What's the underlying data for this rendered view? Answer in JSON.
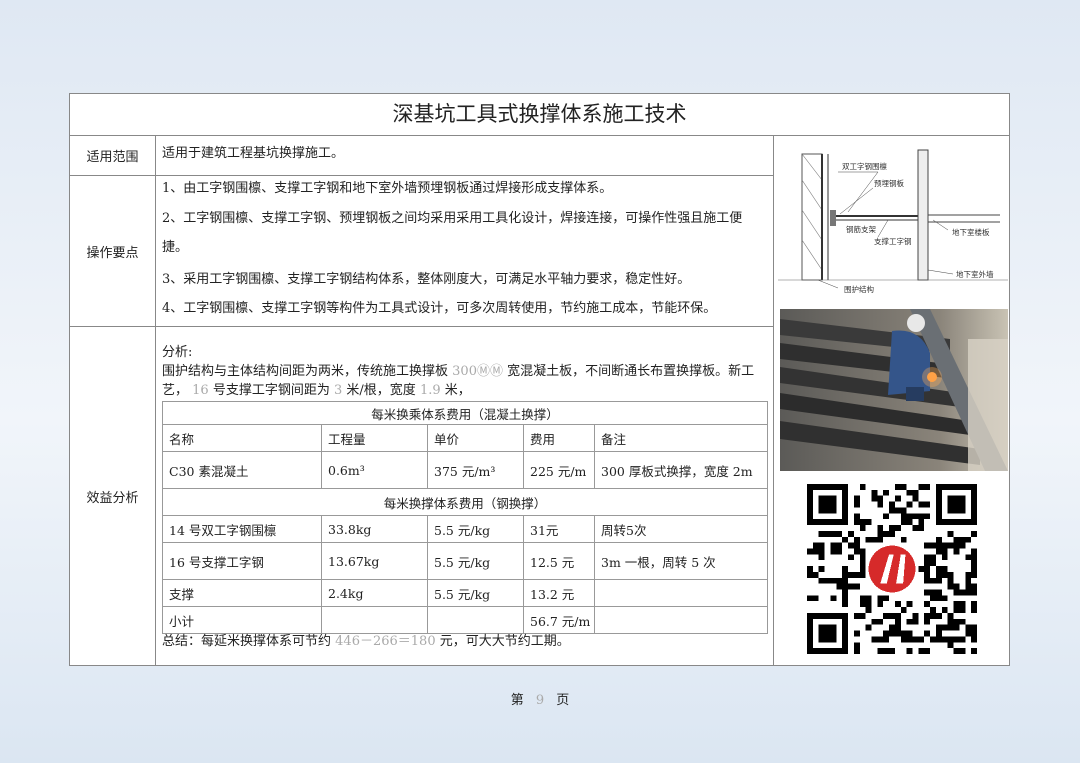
{
  "doc": {
    "title": "深基坑工具式换撑体系施工技术",
    "scope": {
      "label": "适用范围",
      "text": "适用于建筑工程基坑换撑施工。"
    },
    "operation": {
      "label": "操作要点",
      "items": [
        "1、由工字钢围檩、支撑工字钢和地下室外墙预埋钢板通过焊接形成支撑体系。",
        "2、工字钢围檩、支撑工字钢、预埋钢板之间均采用采用工具化设计，焊接连接，可操作性强且施工便",
        "捷。",
        "3、采用工字钢围檩、支撑工字钢结构体系，整体刚度大，可满足水平轴力要求，稳定性好。",
        "4、工字钢围檩、支撑工字钢等构件为工具式设计，可多次周转使用，节约施工成本，节能环保。"
      ]
    },
    "benefit": {
      "label": "效益分析",
      "analysis_label": "分析:",
      "line1_a": "围护结构与主体结构间距为两米，传统施工换撑板",
      "line1_num": "300ⓂⓂ",
      "line1_b": "宽混凝土板，不间断通长布置换撑板。新工",
      "line2_a": "艺，",
      "line2_num1": "16",
      "line2_b": "号支撑工字钢间距为",
      "line2_num2": "3",
      "line2_c": "米/根，宽度",
      "line2_num3": "1.9",
      "line2_d": "米，",
      "table1_title": "每米换乘体系费用（混凝土换撑）",
      "headers": [
        "名称",
        "工程量",
        "单价",
        "费用",
        "备注"
      ],
      "row_concrete": [
        "C30 素混凝土",
        "0.6m³",
        "375 元/m³",
        "225 元/m",
        "300 厚板式换撑，宽度 2m"
      ],
      "table2_title": "每米换撑体系费用（钢换撑）",
      "rows_steel": [
        [
          "14 号双工字钢围檩",
          "33.8kg",
          "5.5 元/kg",
          "31元",
          "周转5次"
        ],
        [
          "16 号支撑工字钢",
          "13.67kg",
          "5.5 元/kg",
          "12.5 元",
          "3m 一根，周转 5 次"
        ],
        [
          "支撑",
          "2.4kg",
          "5.5 元/kg",
          "13.2 元",
          ""
        ]
      ],
      "subtotal": [
        "小计",
        "",
        "",
        "56.7 元/m",
        ""
      ],
      "summary_a": "总结：每延米换撑体系可节约",
      "summary_num": "446－266＝180",
      "summary_b": "元，可大大节约工期。"
    },
    "diagram_labels": {
      "a": "双工字钢围檩",
      "b": "预埋钢板",
      "c": "钢筋支架",
      "d": "支撑工字钢",
      "e": "地下室楼板",
      "f": "围护结构",
      "g": "地下室外墙"
    }
  },
  "page": {
    "prefix": "第",
    "number": "9",
    "suffix": "页"
  }
}
